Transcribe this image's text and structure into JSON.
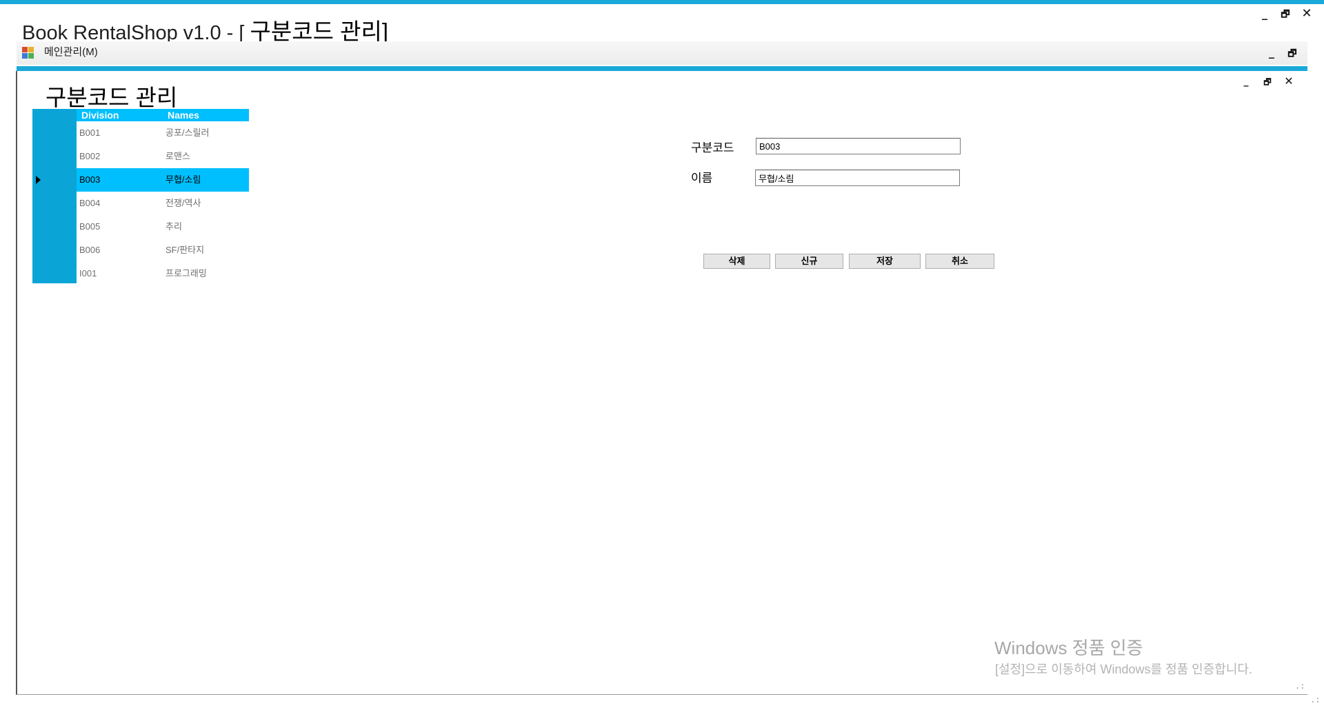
{
  "window": {
    "title_app": "Book RentalShop v1.0 - [",
    "title_child": "구분코드 관리",
    "title_close_bracket": "]",
    "controls": {
      "minimize": "_",
      "maximize": "🗗",
      "close": "✕"
    }
  },
  "menu": {
    "items": [
      {
        "label": "메인관리(M)"
      }
    ],
    "controls": {
      "minimize": "_",
      "maximize": "🗗"
    }
  },
  "child_window": {
    "controls": {
      "minimize": "_",
      "maximize": "🗗",
      "close": "✕"
    }
  },
  "form": {
    "title": "구분코드 관리",
    "grid": {
      "columns": [
        "Division",
        "Names"
      ],
      "rows": [
        {
          "division": "B001",
          "name": "공포/스릴러"
        },
        {
          "division": "B002",
          "name": "로맨스"
        },
        {
          "division": "B003",
          "name": "무협/소림"
        },
        {
          "division": "B004",
          "name": "전쟁/역사"
        },
        {
          "division": "B005",
          "name": "추리"
        },
        {
          "division": "B006",
          "name": "SF/판타지"
        },
        {
          "division": "I001",
          "name": "프로그래밍"
        }
      ],
      "selected_index": 2
    },
    "fields": {
      "code_label": "구분코드",
      "code_value": "B003",
      "name_label": "이름",
      "name_value": "무협/소림"
    },
    "buttons": {
      "delete": "삭제",
      "new": "신규",
      "save": "저장",
      "cancel": "취소"
    }
  },
  "watermark": {
    "line1": "Windows 정품 인증",
    "line2": "[설정]으로 이동하여 Windows를 정품 인증합니다."
  },
  "colors": {
    "accent": "#1aa9d8",
    "grid_header": "#00bfff",
    "selected_row": "#00bfff",
    "row_header": "#0aa5d6"
  }
}
